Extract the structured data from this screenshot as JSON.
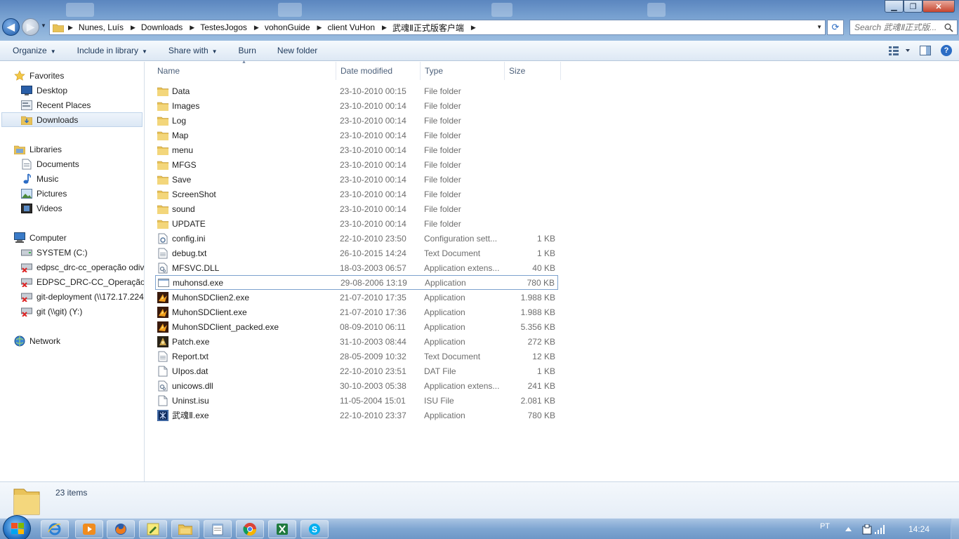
{
  "window": {
    "controls": {
      "minimize": "▁",
      "maximize": "❐",
      "close": "✕"
    }
  },
  "address": {
    "breadcrumbs": [
      "Nunes, Luís",
      "Downloads",
      "TestesJogos",
      "vohonGuide",
      "client VuHon",
      "武魂Ⅱ正式版客户端"
    ],
    "search_placeholder": "Search 武魂Ⅱ正式版..."
  },
  "commands": {
    "organize": "Organize",
    "include_in_library": "Include in library",
    "share_with": "Share with",
    "burn": "Burn",
    "new_folder": "New folder"
  },
  "nav": {
    "favorites": {
      "label": "Favorites",
      "items": [
        "Desktop",
        "Recent Places",
        "Downloads"
      ]
    },
    "libraries": {
      "label": "Libraries",
      "items": [
        "Documents",
        "Music",
        "Pictures",
        "Videos"
      ]
    },
    "computer": {
      "label": "Computer",
      "items": [
        "SYSTEM (C:)",
        "edpsc_drc-cc_operação odive",
        "EDPSC_DRC-CC_Operação Se",
        "git-deployment (\\\\172.17.224",
        "git (\\\\git) (Y:)"
      ]
    },
    "network": {
      "label": "Network"
    }
  },
  "columns": {
    "name": "Name",
    "date_modified": "Date modified",
    "type": "Type",
    "size": "Size"
  },
  "files": [
    {
      "name": "Data",
      "date": "23-10-2010 00:15",
      "type": "File folder",
      "size": "",
      "icon": "folder-icon"
    },
    {
      "name": "Images",
      "date": "23-10-2010 00:14",
      "type": "File folder",
      "size": "",
      "icon": "folder-icon"
    },
    {
      "name": "Log",
      "date": "23-10-2010 00:14",
      "type": "File folder",
      "size": "",
      "icon": "folder-icon"
    },
    {
      "name": "Map",
      "date": "23-10-2010 00:14",
      "type": "File folder",
      "size": "",
      "icon": "folder-icon"
    },
    {
      "name": "menu",
      "date": "23-10-2010 00:14",
      "type": "File folder",
      "size": "",
      "icon": "folder-icon"
    },
    {
      "name": "MFGS",
      "date": "23-10-2010 00:14",
      "type": "File folder",
      "size": "",
      "icon": "folder-icon"
    },
    {
      "name": "Save",
      "date": "23-10-2010 00:14",
      "type": "File folder",
      "size": "",
      "icon": "folder-icon"
    },
    {
      "name": "ScreenShot",
      "date": "23-10-2010 00:14",
      "type": "File folder",
      "size": "",
      "icon": "folder-icon"
    },
    {
      "name": "sound",
      "date": "23-10-2010 00:14",
      "type": "File folder",
      "size": "",
      "icon": "folder-icon"
    },
    {
      "name": "UPDATE",
      "date": "23-10-2010 00:14",
      "type": "File folder",
      "size": "",
      "icon": "folder-icon"
    },
    {
      "name": "config.ini",
      "date": "22-10-2010 23:50",
      "type": "Configuration sett...",
      "size": "1 KB",
      "icon": "config-file-icon"
    },
    {
      "name": "debug.txt",
      "date": "26-10-2015 14:24",
      "type": "Text Document",
      "size": "1 KB",
      "icon": "text-file-icon"
    },
    {
      "name": "MFSVC.DLL",
      "date": "18-03-2003 06:57",
      "type": "Application extens...",
      "size": "40 KB",
      "icon": "dll-file-icon"
    },
    {
      "name": "muhonsd.exe",
      "date": "29-08-2006 13:19",
      "type": "Application",
      "size": "780 KB",
      "icon": "exe-generic-icon"
    },
    {
      "name": "MuhonSDClien2.exe",
      "date": "21-07-2010 17:35",
      "type": "Application",
      "size": "1.988 KB",
      "icon": "game-app-icon"
    },
    {
      "name": "MuhonSDClient.exe",
      "date": "21-07-2010 17:36",
      "type": "Application",
      "size": "1.988 KB",
      "icon": "game-app-icon"
    },
    {
      "name": "MuhonSDClient_packed.exe",
      "date": "08-09-2010 06:11",
      "type": "Application",
      "size": "5.356 KB",
      "icon": "game-app-icon"
    },
    {
      "name": "Patch.exe",
      "date": "31-10-2003 08:44",
      "type": "Application",
      "size": "272 KB",
      "icon": "patch-app-icon"
    },
    {
      "name": "Report.txt",
      "date": "28-05-2009 10:32",
      "type": "Text Document",
      "size": "12 KB",
      "icon": "text-file-icon"
    },
    {
      "name": "UIpos.dat",
      "date": "22-10-2010 23:51",
      "type": "DAT File",
      "size": "1 KB",
      "icon": "blank-file-icon"
    },
    {
      "name": "unicows.dll",
      "date": "30-10-2003 05:38",
      "type": "Application extens...",
      "size": "241 KB",
      "icon": "dll-file-icon"
    },
    {
      "name": "Uninst.isu",
      "date": "11-05-2004 15:01",
      "type": "ISU File",
      "size": "2.081 KB",
      "icon": "blank-file-icon"
    },
    {
      "name": "武魂Ⅱ.exe",
      "date": "22-10-2010 23:37",
      "type": "Application",
      "size": "780 KB",
      "icon": "wuhun-app-icon"
    }
  ],
  "status": {
    "item_count": "23 items"
  },
  "taskbar": {
    "apps": [
      "internet-explorer-icon",
      "media-player-icon",
      "firefox-icon",
      "notes-icon",
      "file-explorer-icon",
      "notepad-icon",
      "chrome-icon",
      "excel-icon",
      "skype-icon"
    ],
    "language": "PT",
    "clock": "14:24"
  }
}
